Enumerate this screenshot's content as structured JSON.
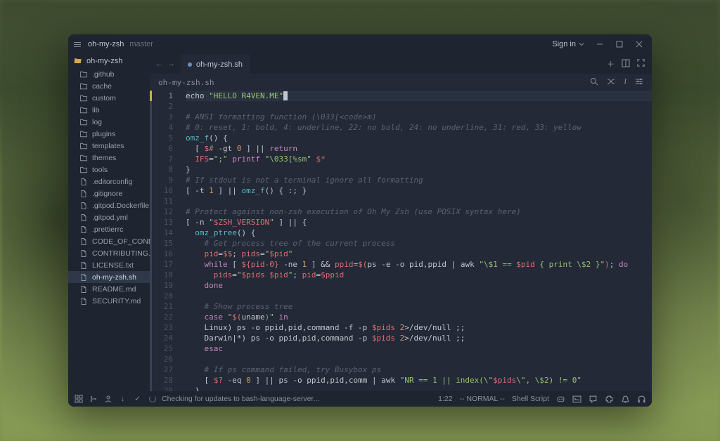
{
  "titlebar": {
    "title": "oh-my-zsh",
    "branch": "master",
    "signin": "Sign in"
  },
  "sidebar": {
    "root": "oh-my-zsh",
    "items": [
      {
        "icon": "folder",
        "label": ".github"
      },
      {
        "icon": "folder",
        "label": "cache"
      },
      {
        "icon": "folder",
        "label": "custom"
      },
      {
        "icon": "folder",
        "label": "lib"
      },
      {
        "icon": "folder",
        "label": "log"
      },
      {
        "icon": "folder",
        "label": "plugins"
      },
      {
        "icon": "folder",
        "label": "templates"
      },
      {
        "icon": "folder",
        "label": "themes"
      },
      {
        "icon": "folder",
        "label": "tools"
      },
      {
        "icon": "file",
        "label": ".editorconfig"
      },
      {
        "icon": "file",
        "label": ".gitignore"
      },
      {
        "icon": "file",
        "label": ".gitpod.Dockerfile"
      },
      {
        "icon": "file",
        "label": ".gitpod.yml"
      },
      {
        "icon": "file",
        "label": ".prettierrc"
      },
      {
        "icon": "file",
        "label": "CODE_OF_CONDUCT.m"
      },
      {
        "icon": "file",
        "label": "CONTRIBUTING.md"
      },
      {
        "icon": "file",
        "label": "LICENSE.txt"
      },
      {
        "icon": "file",
        "label": "oh-my-zsh.sh",
        "selected": true
      },
      {
        "icon": "file",
        "label": "README.md"
      },
      {
        "icon": "file",
        "label": "SECURITY.md"
      }
    ]
  },
  "tab": {
    "name": "oh-my-zsh.sh",
    "modified": true
  },
  "pathbar": "oh-my-zsh.sh",
  "code": {
    "first_line": 1,
    "lines": [
      {
        "t": "echo ",
        "cls": "c-cmd",
        "suffix": {
          "t": "\"HELLO R4VEN.ME\"",
          "cls": "c-str"
        },
        "cursor": true,
        "hl": true
      },
      {
        "t": ""
      },
      {
        "t": "# ANSI formatting function (\\033[<code>m)",
        "cls": "c-cmt"
      },
      {
        "t": "# 0: reset, 1: bold, 4: underline, 22: no bold, 24: no underline, 31: red, 33: yellow",
        "cls": "c-cmt"
      },
      {
        "raw": "<span class='c-fn'>omz_f</span><span class='c-op'>() {</span>"
      },
      {
        "raw": "  <span class='c-op'>[ </span><span class='c-var'>$#</span><span class='c-op'> -gt </span><span class='c-num'>0</span><span class='c-op'> ] || </span><span class='c-kw'>return</span>"
      },
      {
        "raw": "  <span class='c-var'>IFS</span><span class='c-op'>=</span><span class='c-str'>\";\"</span> <span class='c-kw'>printf</span> <span class='c-str'>\"\\033[%sm\"</span> <span class='c-var'>$*</span>"
      },
      {
        "raw": "<span class='c-op'>}</span>"
      },
      {
        "t": "# If stdout is not a terminal ignore all formatting",
        "cls": "c-cmt"
      },
      {
        "raw": "<span class='c-op'>[ -t </span><span class='c-num'>1</span><span class='c-op'> ] || </span><span class='c-fn'>omz_f</span><span class='c-op'>() { :; }</span>"
      },
      {
        "t": ""
      },
      {
        "t": "# Protect against non-zsh execution of Oh My Zsh (use POSIX syntax here)",
        "cls": "c-cmt"
      },
      {
        "raw": "<span class='c-op'>[ -n </span><span class='c-str'>\"</span><span class='c-var'>$ZSH_VERSION</span><span class='c-str'>\"</span><span class='c-op'> ] || {</span>"
      },
      {
        "raw": "  <span class='c-fn'>omz_ptree</span><span class='c-op'>() {</span>"
      },
      {
        "raw": "    <span class='c-cmt'># Get process tree of the current process</span>"
      },
      {
        "raw": "    <span class='c-var'>pid</span><span class='c-op'>=</span><span class='c-var'>$$</span><span class='c-op'>; </span><span class='c-var'>pids</span><span class='c-op'>=</span><span class='c-str'>\"</span><span class='c-var'>$pid</span><span class='c-str'>\"</span>"
      },
      {
        "raw": "    <span class='c-kw'>while</span><span class='c-op'> [ </span><span class='c-var'>${pid-0}</span><span class='c-op'> -ne </span><span class='c-num'>1</span><span class='c-op'> ] && </span><span class='c-var'>ppid</span><span class='c-op'>=</span><span class='c-var'>$(</span><span class='c-cmd'>ps -e -o pid,ppid</span><span class='c-op'> | </span><span class='c-cmd'>awk </span><span class='c-str'>\"\\$1 == </span><span class='c-var'>$pid</span><span class='c-str'> { print \\$2 }\"</span><span class='c-var'>)</span><span class='c-op'>; </span><span class='c-kw'>do</span>"
      },
      {
        "raw": "      <span class='c-var'>pids</span><span class='c-op'>=</span><span class='c-str'>\"</span><span class='c-var'>$pids $pid</span><span class='c-str'>\"</span><span class='c-op'>; </span><span class='c-var'>pid</span><span class='c-op'>=</span><span class='c-var'>$ppid</span>"
      },
      {
        "raw": "    <span class='c-kw'>done</span>"
      },
      {
        "t": ""
      },
      {
        "raw": "    <span class='c-cmt'># Show process tree</span>"
      },
      {
        "raw": "    <span class='c-kw'>case</span> <span class='c-str'>\"</span><span class='c-var'>$(</span><span class='c-cmd'>uname</span><span class='c-var'>)</span><span class='c-str'>\"</span> <span class='c-kw'>in</span>"
      },
      {
        "raw": "    <span class='c-op'>Linux) </span><span class='c-cmd'>ps -o ppid,pid,command -f -p </span><span class='c-var'>$pids</span> <span class='c-num'>2</span><span class='c-op'>&gt;/dev/null ;;</span>"
      },
      {
        "raw": "    <span class='c-op'>Darwin|*) </span><span class='c-cmd'>ps -o ppid,pid,command -p </span><span class='c-var'>$pids</span> <span class='c-num'>2</span><span class='c-op'>&gt;/dev/null ;;</span>"
      },
      {
        "raw": "    <span class='c-kw'>esac</span>"
      },
      {
        "t": ""
      },
      {
        "raw": "    <span class='c-cmt'># If ps command failed, try Busybox ps</span>"
      },
      {
        "raw": "    <span class='c-op'>[ </span><span class='c-var'>$?</span><span class='c-op'> -eq </span><span class='c-num'>0</span><span class='c-op'> ] || </span><span class='c-cmd'>ps -o ppid,pid,comm</span><span class='c-op'> | </span><span class='c-cmd'>awk </span><span class='c-str'>\"NR == 1 || index(\\\"</span><span class='c-var'>$pids</span><span class='c-str'>\\\", \\$2) != 0\"</span>"
      },
      {
        "raw": "  <span class='c-op'>}</span>"
      },
      {
        "t": ""
      }
    ]
  },
  "status": {
    "message": "Checking for updates to bash-language-server...",
    "position": "1:22",
    "mode": "-- NORMAL --",
    "filetype": "Shell Script"
  }
}
